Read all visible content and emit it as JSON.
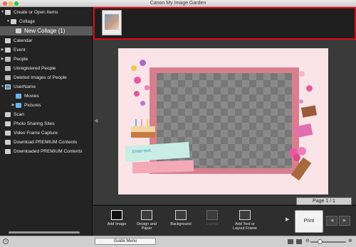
{
  "window": {
    "title": "Canon My Image Garden"
  },
  "sidebar": {
    "items": [
      {
        "label": "Create or Open Items"
      },
      {
        "label": "Collage"
      },
      {
        "label": "New Collage (1)"
      },
      {
        "label": "Calendar"
      },
      {
        "label": "Event"
      },
      {
        "label": "People"
      },
      {
        "label": "Unregistered People"
      },
      {
        "label": "Deleted Images of People"
      },
      {
        "label": "UserName"
      },
      {
        "label": "Movies"
      },
      {
        "label": "Pictures"
      },
      {
        "label": "Scan"
      },
      {
        "label": "Photo Sharing Sites"
      },
      {
        "label": "Video Frame Capture"
      },
      {
        "label": "Download PREMIUM Contents"
      },
      {
        "label": "Downloaded PREMIUM Contents"
      }
    ]
  },
  "canvas": {
    "placeholder_text": "Enter text.",
    "page_indicator": "Page 1 / 1"
  },
  "toolbar": {
    "add_image": "Add Image",
    "design_and_paper": "Design and Paper",
    "background": "Background",
    "layout": "Layout",
    "add_text": "Add Text or Layout Frame",
    "print": "Print"
  },
  "statusbar": {
    "guide_menu": "Guide Menu"
  },
  "colors": {
    "highlight": "#e30613",
    "accent_folder": "#6fb3e8"
  }
}
